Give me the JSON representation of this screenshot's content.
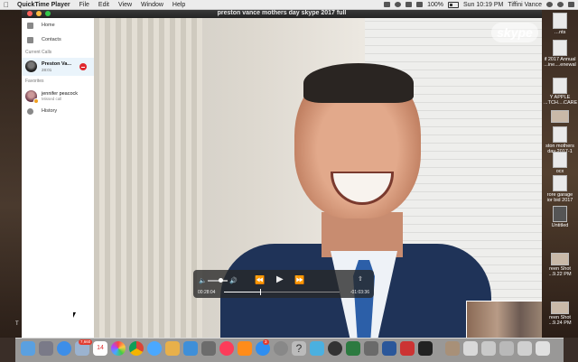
{
  "menubar": {
    "app_name": "QuickTime Player",
    "menus": [
      "File",
      "Edit",
      "View",
      "Window",
      "Help"
    ],
    "battery": "100%",
    "clock": "Sun 10:19 PM",
    "user": "Tiffini Vance"
  },
  "window": {
    "title": "preston vance mothers day skype 2017 full"
  },
  "sidebar": {
    "home_label": "Home",
    "contacts_label": "Contacts",
    "current_calls_heading": "Current Calls",
    "current_call": {
      "name": "Preston Va...",
      "duration": "28:01"
    },
    "favorites_heading": "Favorites",
    "favorite": {
      "name": "jennifer peacock",
      "status": "Missed call"
    },
    "history_label": "History"
  },
  "video": {
    "logo_text": "skype"
  },
  "player": {
    "elapsed": "00:28:04",
    "remaining": "-01:03:36",
    "progress": 0.31,
    "volume": 0.65
  },
  "desktop_files": [
    {
      "label": "…nts",
      "kind": "doc"
    },
    {
      "label": "if 2017 Annual ...ine....enewal",
      "kind": "doc"
    },
    {
      "label": "Y APPLE ...TCH....CARE",
      "kind": "doc"
    },
    {
      "label": "",
      "kind": "img"
    },
    {
      "label": "ston mothers day 2017-1",
      "kind": "doc"
    },
    {
      "label": "ocx",
      "kind": "doc"
    },
    {
      "label": "rore garage ior bid 2017",
      "kind": "doc"
    },
    {
      "label": "Untitled",
      "kind": "blank"
    },
    {
      "label": "reen Shot ...9.22 PM",
      "kind": "img"
    },
    {
      "label": "reen Shot ...9.24 PM",
      "kind": "img"
    }
  ],
  "dock": {
    "mail_badge": "7,660",
    "calendar_date": "14",
    "badge_2": "3"
  },
  "colors": {
    "call_bg": "#eaf4fb",
    "hangup": "#e0282e"
  },
  "icons": [
    "apple-icon",
    "wifi-icon",
    "volume-icon",
    "battery-icon",
    "search-icon",
    "siri-icon",
    "list-icon",
    "home-icon",
    "contacts-icon",
    "history-icon",
    "hang-up-icon"
  ]
}
